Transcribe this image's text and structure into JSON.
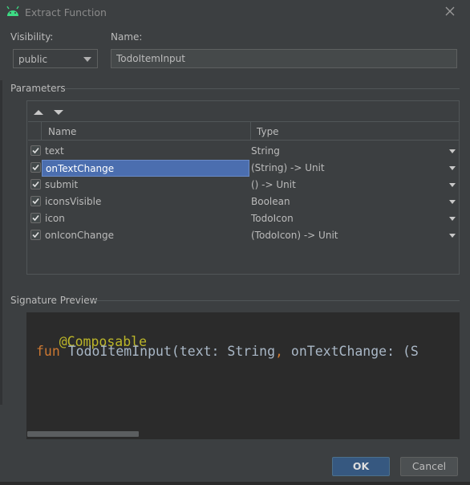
{
  "window": {
    "title": "Extract Function",
    "close_icon": "close-icon",
    "app_icon": "android-icon"
  },
  "visibility": {
    "label": "Visibility:",
    "value": "public"
  },
  "name": {
    "label": "Name:",
    "value": "TodoItemInput"
  },
  "parameters": {
    "section_title": "Parameters",
    "columns": [
      "Name",
      "Type"
    ],
    "rows": [
      {
        "checked": true,
        "name": "text",
        "type": "String",
        "selected": false
      },
      {
        "checked": true,
        "name": "onTextChange",
        "type": "(String) -> Unit",
        "selected": true
      },
      {
        "checked": true,
        "name": "submit",
        "type": "() -> Unit",
        "selected": false
      },
      {
        "checked": true,
        "name": "iconsVisible",
        "type": "Boolean",
        "selected": false
      },
      {
        "checked": true,
        "name": "icon",
        "type": "TodoIcon",
        "selected": false
      },
      {
        "checked": true,
        "name": "onIconChange",
        "type": "(TodoIcon) -> Unit",
        "selected": false
      }
    ]
  },
  "signature": {
    "section_title": "Signature Preview",
    "line1": "@Composable",
    "line2_kw": "fun",
    "line2_a": " TodoItemInput(text: String",
    "line2_comma": ",",
    "line2_b": " onTextChange: (S"
  },
  "buttons": {
    "ok": "OK",
    "cancel": "Cancel"
  },
  "colors": {
    "background": "#3c3f41",
    "selection": "#4b6eaf",
    "primary_button": "#365880",
    "editor_bg": "#2b2b2b"
  }
}
